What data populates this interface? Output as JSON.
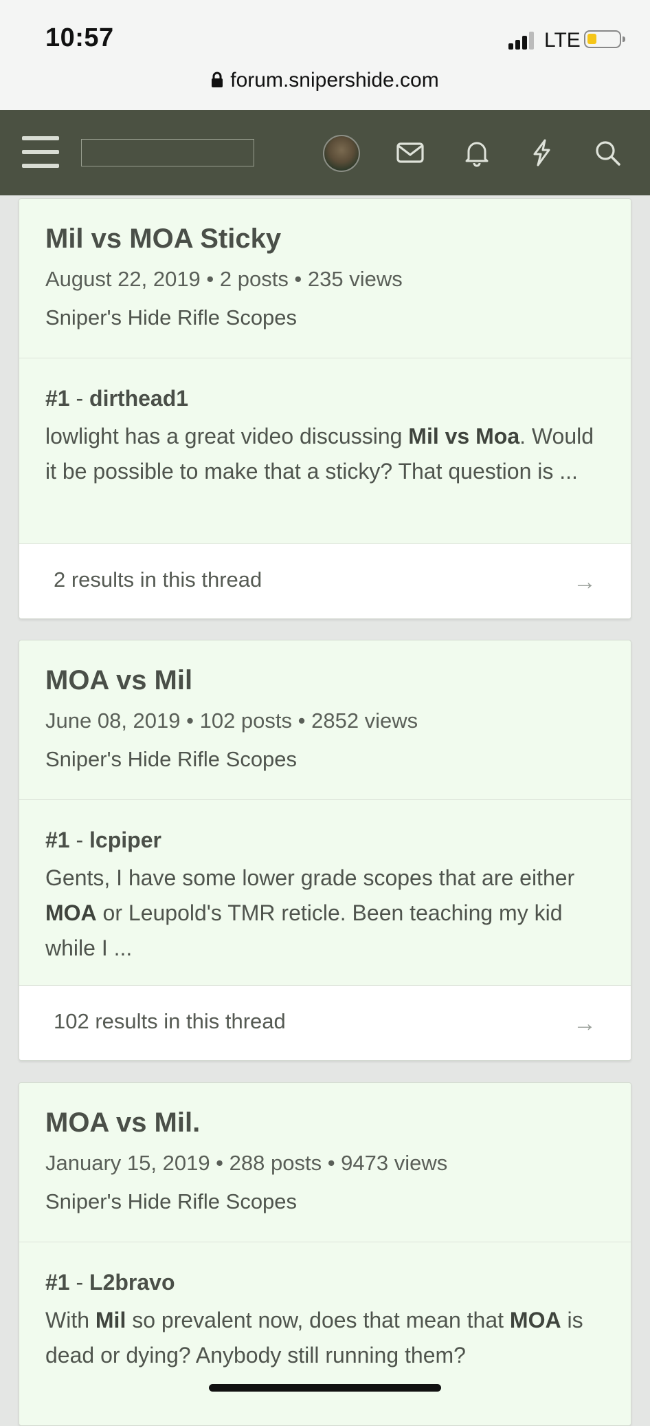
{
  "status": {
    "time": "10:57",
    "network": "LTE",
    "url": "forum.snipershide.com"
  },
  "icons": [
    "lock-icon",
    "menu-icon",
    "avatar",
    "mail-icon",
    "bell-icon",
    "lightning-icon",
    "search-icon",
    "arrow-right-icon"
  ],
  "results": [
    {
      "title": "Mil vs MOA Sticky",
      "meta": "August 22, 2019 • 2 posts • 235 views",
      "forum": "Sniper's Hide Rifle Scopes",
      "post_num": "#1",
      "post_sep": " - ",
      "author": "dirthead1",
      "snippet": [
        {
          "t": "lowlight has a great video discussing "
        },
        {
          "t": "Mil vs Moa",
          "b": true
        },
        {
          "t": ". Would it be possible to make that a sticky? That question is ..."
        }
      ],
      "footer": "2 results in this thread",
      "arrow": "→"
    },
    {
      "title": "MOA vs Mil",
      "meta": "June 08, 2019 • 102 posts • 2852 views",
      "forum": "Sniper's Hide Rifle Scopes",
      "post_num": "#1",
      "post_sep": " - ",
      "author": "lcpiper",
      "snippet": [
        {
          "t": "Gents, I have some lower grade scopes that are either "
        },
        {
          "t": "MOA",
          "b": true
        },
        {
          "t": " or Leupold's TMR reticle. Been teaching my kid while I ..."
        }
      ],
      "footer": "102 results in this thread",
      "arrow": "→"
    },
    {
      "title": "MOA vs Mil.",
      "meta": "January 15, 2019 • 288 posts • 9473 views",
      "forum": "Sniper's Hide Rifle Scopes",
      "post_num": "#1",
      "post_sep": " - ",
      "author": "L2bravo",
      "snippet": [
        {
          "t": "With "
        },
        {
          "t": "Mil",
          "b": true
        },
        {
          "t": " so prevalent now, does that mean that "
        },
        {
          "t": "MOA",
          "b": true
        },
        {
          "t": " is dead or dying? Anybody still running them?"
        }
      ],
      "footer": "",
      "arrow": ""
    }
  ]
}
